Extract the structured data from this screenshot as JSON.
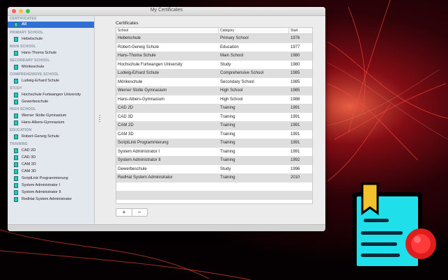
{
  "window": {
    "title": "My Certificates"
  },
  "sidebar": {
    "groups": [
      {
        "header": "CERTIFICATES",
        "items": [
          "All"
        ]
      },
      {
        "header": "PRIMARY SCHOOL",
        "items": [
          "Hebelschule"
        ]
      },
      {
        "header": "MAIN SCHOOL",
        "items": [
          "Hans-Thoma Schule"
        ]
      },
      {
        "header": "SECONDARY SCHOOL",
        "items": [
          "Mörikeschule"
        ]
      },
      {
        "header": "COMPREHENSIVE SCHOOL",
        "items": [
          "Ludwig-Erhard Schule"
        ]
      },
      {
        "header": "STUDY",
        "items": [
          "Hochschule Furtwangen University",
          "Gewerbeschule"
        ]
      },
      {
        "header": "HIGH SCHOOL",
        "items": [
          "Werner Stolte Gymnasium",
          "Hans-Albers-Gymnasium"
        ]
      },
      {
        "header": "EDUCATION",
        "items": [
          "Robert-Gerwig Schule"
        ]
      },
      {
        "header": "TRAINING",
        "items": [
          "CAD 2D",
          "CAD 3D",
          "CAM 2D",
          "CAM 3D",
          "ScriptLink Programmierung",
          "System Administrator I",
          "System Administrator II",
          "RedHat System Administrator"
        ]
      }
    ],
    "selected": "All"
  },
  "main": {
    "section_title": "Certificates",
    "columns": [
      "School",
      "Category",
      "Start"
    ],
    "rows": [
      [
        "Hebelschule",
        "Primary School",
        "1976"
      ],
      [
        "Robert-Gerwig Schule",
        "Education",
        "1977"
      ],
      [
        "Hans-Thoma Schule",
        "Main School",
        "1980"
      ],
      [
        "Hochschule Furtwangen University",
        "Study",
        "1980"
      ],
      [
        "Ludwig-Erhard Schule",
        "Comprehensive School",
        "1985"
      ],
      [
        "Mörikeschule",
        "Secondary School",
        "1985"
      ],
      [
        "Werner Stolte Gymnasium",
        "High School",
        "1985"
      ],
      [
        "Hans-Albers-Gymnasium",
        "High School",
        "1988"
      ],
      [
        "CAD 2D",
        "Training",
        "1991"
      ],
      [
        "CAD 3D",
        "Training",
        "1991"
      ],
      [
        "CAM 2D",
        "Training",
        "1991"
      ],
      [
        "CAM 3D",
        "Training",
        "1991"
      ],
      [
        "ScriptLink Programmierung",
        "Training",
        "1991"
      ],
      [
        "System Administrator I",
        "Training",
        "1991"
      ],
      [
        "System Administrator II",
        "Training",
        "1992"
      ],
      [
        "Gewerbeschule",
        "Study",
        "1996"
      ],
      [
        "RedHat System Administrator",
        "Training",
        "2010"
      ]
    ],
    "add_label": "+",
    "remove_label": "−"
  },
  "colors": {
    "selection": "#2f6fd6",
    "icon_accent": "#26c8c0",
    "app_icon_yellow": "#f2c12e",
    "app_icon_red": "#e01d1d"
  }
}
